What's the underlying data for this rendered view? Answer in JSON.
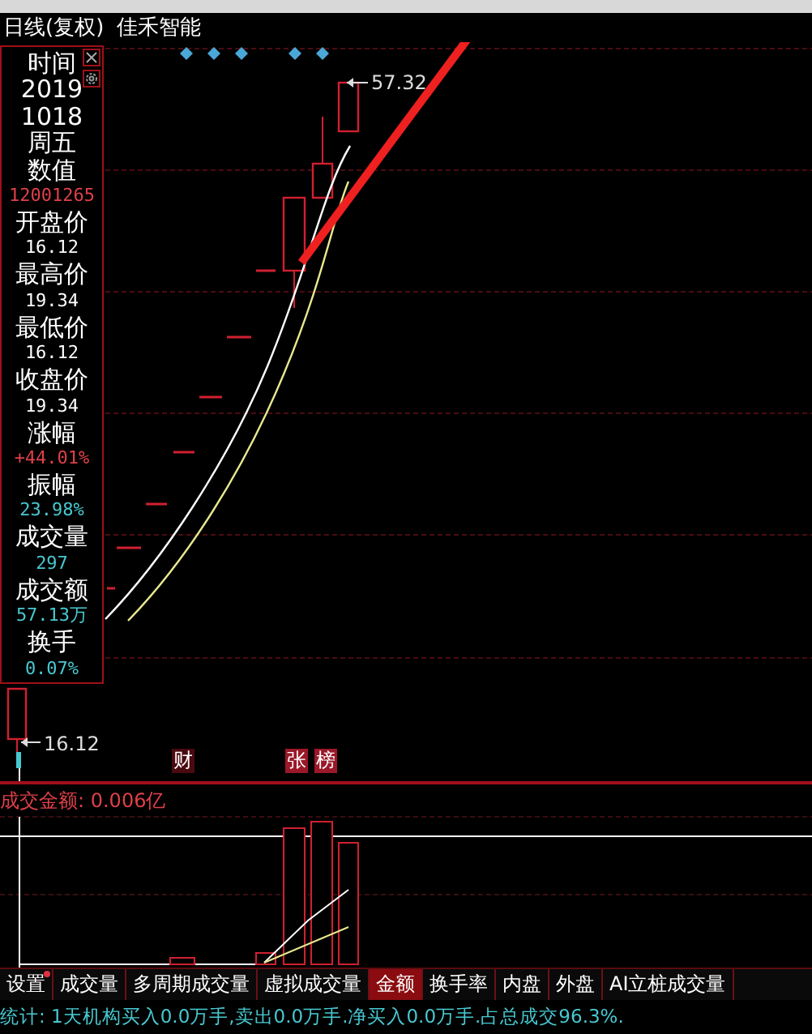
{
  "header": {
    "period": "日线(复权)",
    "stock_name": "佳禾智能"
  },
  "info_panel": {
    "lines": [
      {
        "text": "时间",
        "kind": "label",
        "color": "#ffffff"
      },
      {
        "text": "2019",
        "kind": "label",
        "color": "#ffffff"
      },
      {
        "text": "1018",
        "kind": "label",
        "color": "#ffffff"
      },
      {
        "text": "周五",
        "kind": "label",
        "color": "#ffffff"
      },
      {
        "text": "数值",
        "kind": "label",
        "color": "#ffffff"
      },
      {
        "text": "12001265",
        "kind": "value",
        "color": "#e0404a"
      },
      {
        "text": "开盘价",
        "kind": "label",
        "color": "#ffffff"
      },
      {
        "text": "16.12",
        "kind": "value",
        "color": "#ffffff"
      },
      {
        "text": "最高价",
        "kind": "label",
        "color": "#ffffff"
      },
      {
        "text": "19.34",
        "kind": "value",
        "color": "#ffffff"
      },
      {
        "text": "最低价",
        "kind": "label",
        "color": "#ffffff"
      },
      {
        "text": "16.12",
        "kind": "value",
        "color": "#ffffff"
      },
      {
        "text": "收盘价",
        "kind": "label",
        "color": "#ffffff"
      },
      {
        "text": "19.34",
        "kind": "value",
        "color": "#ffffff"
      },
      {
        "text": "涨幅",
        "kind": "label",
        "color": "#ffffff"
      },
      {
        "text": "+44.01%",
        "kind": "value",
        "color": "#e0404a"
      },
      {
        "text": "振幅",
        "kind": "label",
        "color": "#ffffff"
      },
      {
        "text": "23.98%",
        "kind": "value",
        "color": "#48c8d0"
      },
      {
        "text": "成交量",
        "kind": "label",
        "color": "#ffffff"
      },
      {
        "text": "297",
        "kind": "value",
        "color": "#48c8d0"
      },
      {
        "text": "成交额",
        "kind": "label",
        "color": "#ffffff"
      },
      {
        "text": "57.13万",
        "kind": "value",
        "color": "#48c8d0"
      },
      {
        "text": "换手",
        "kind": "label",
        "color": "#ffffff"
      },
      {
        "text": "0.07%",
        "kind": "value",
        "color": "#48c8d0"
      }
    ]
  },
  "chart": {
    "high_label": "57.32",
    "low_label": "16.12",
    "markers": [
      {
        "text": "财",
        "highlighted": false
      },
      {
        "text": "张",
        "highlighted": true
      },
      {
        "text": "榜",
        "highlighted": true
      }
    ]
  },
  "volume_panel": {
    "title": "成交金额: 0.006亿"
  },
  "tabs": [
    {
      "label": "设置",
      "selected": false,
      "dot": true
    },
    {
      "label": "成交量",
      "selected": false,
      "dot": false
    },
    {
      "label": "多周期成交量",
      "selected": false,
      "dot": false
    },
    {
      "label": "虚拟成交量",
      "selected": false,
      "dot": false
    },
    {
      "label": "金额",
      "selected": true,
      "dot": false
    },
    {
      "label": "换手率",
      "selected": false,
      "dot": false
    },
    {
      "label": "内盘",
      "selected": false,
      "dot": false
    },
    {
      "label": "外盘",
      "selected": false,
      "dot": false
    },
    {
      "label": "AI立桩成交量",
      "selected": false,
      "dot": false
    }
  ],
  "status": "统计: 1天机构买入0.0万手,卖出0.0万手.净买入0.0万手.占总成交96.3%."
}
